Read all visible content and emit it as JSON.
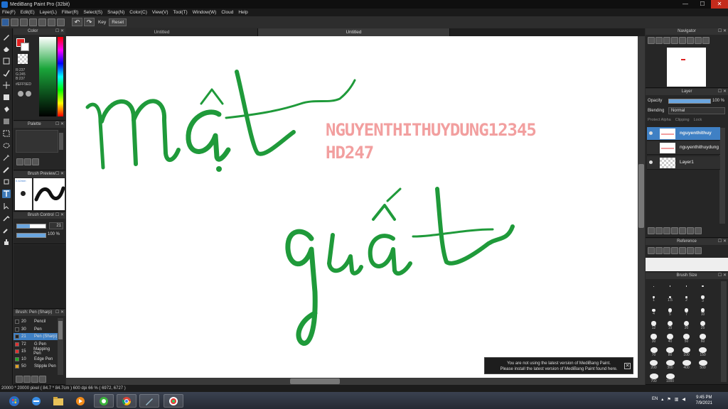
{
  "window": {
    "title": "MediBang Paint Pro (32bit)",
    "minimize": "—",
    "maximize": "☐",
    "close": "✕"
  },
  "menu": [
    "File(F)",
    "Edit(E)",
    "Layer(L)",
    "Filter(R)",
    "Select(S)",
    "Snap(N)",
    "Color(C)",
    "View(V)",
    "Tool(T)",
    "Window(W)",
    "Cloud",
    "Help"
  ],
  "toolbar": {
    "key_label": "Key",
    "reset_label": "Reset",
    "undo_glyph": "↶",
    "redo_glyph": "↷"
  },
  "tabs": [
    "Untitled",
    "Untitled"
  ],
  "panels": {
    "color": {
      "title": "Color",
      "rgb": [
        "R:237",
        "G:245",
        "B:237"
      ],
      "hex": "#EFF5ED"
    },
    "palette": {
      "title": "Palette"
    },
    "brush_preview": {
      "title": "Brush Preview",
      "size_label": "0.42mm"
    },
    "brush_control": {
      "title": "Brush Control",
      "size_value": "21",
      "opacity_value": "100 %"
    },
    "brush_list": {
      "title": "Brush: Pen (Sharp)",
      "items": [
        {
          "num": "20",
          "name": "Pencil",
          "color": "#222222"
        },
        {
          "num": "30",
          "name": "Pen",
          "color": "#222222"
        },
        {
          "num": "21",
          "name": "Pen (Sharp)",
          "color": "#222222"
        },
        {
          "num": "72",
          "name": "G Pen",
          "color": "#e03030"
        },
        {
          "num": "15",
          "name": "Mapping Pen",
          "color": "#e03030"
        },
        {
          "num": "10",
          "name": "Edge Pen",
          "color": "#22aa22"
        },
        {
          "num": "50",
          "name": "Stipple Pen",
          "color": "#e0a020"
        }
      ]
    }
  },
  "canvas": {
    "word1": "mật",
    "word2": "quất",
    "stroke_color": "#1f9a3a",
    "watermark_line1": "NGUYENTHITHUYDUNG12345",
    "watermark_line2": "HD247",
    "watermark_color": "#f29f9f"
  },
  "notification": {
    "line1": "You are not using the latest version of MediBang Paint.",
    "line2": "Please install the latest version of MediBang Paint found here.",
    "close": "✕"
  },
  "navigator": {
    "title": "Navigator"
  },
  "layer_panel": {
    "title": "Layer",
    "opacity_label": "Opacity",
    "opacity_value": "100 %",
    "blending_label": "Blending",
    "blending_value": "Normal",
    "protect_alpha": "Protect Alpha",
    "clipping": "Clipping",
    "lock": "Lock",
    "layers": [
      "nguyenthithuy",
      "nguyenthithuydung",
      "Layer1"
    ]
  },
  "reference": {
    "title": "Reference"
  },
  "brush_size": {
    "title": "Brush Size",
    "labels": [
      "",
      "",
      "",
      "",
      "1",
      "1.5",
      "2",
      "3",
      "4",
      "5",
      "7",
      "10",
      "12",
      "15",
      "20",
      "25",
      "30",
      "40",
      "50",
      "60",
      "70",
      "80",
      "100",
      "150",
      "200",
      "300",
      "400",
      "500",
      "700",
      "1000"
    ]
  },
  "status": "20000 * 20000 pixel  ( 84.7 * 84.7cm )  600 dpi  66 %  ( 6972, 6727 )",
  "taskbar": {
    "lang": "EN",
    "time": "9:45 PM",
    "date": "7/9/2021"
  }
}
